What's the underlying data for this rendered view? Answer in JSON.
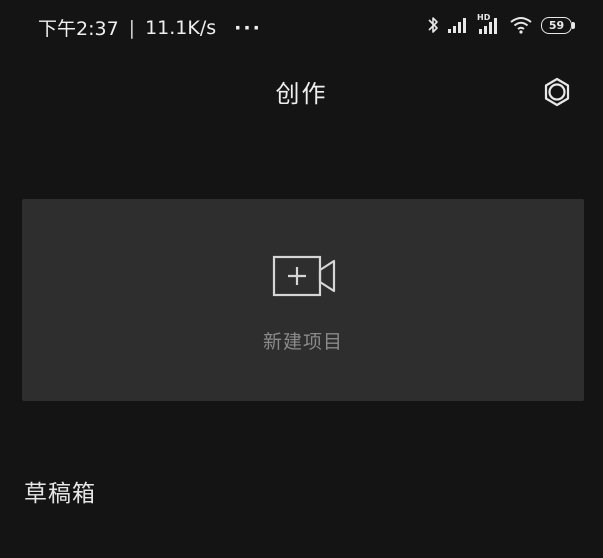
{
  "status_bar": {
    "time": "下午2:37",
    "separator": "|",
    "network_speed": "11.1K/s",
    "more": "···",
    "hd_label": "HD",
    "battery_level": "59",
    "icons": [
      "bluetooth-icon",
      "signal-icon",
      "signal-hd-icon",
      "wifi-icon",
      "battery-icon"
    ]
  },
  "header": {
    "title": "创作",
    "settings_icon": "settings-icon"
  },
  "new_project": {
    "label": "新建项目",
    "icon": "add-video-icon"
  },
  "drafts": {
    "title": "草稿箱"
  },
  "colors": {
    "background": "#141414",
    "card": "#2e2e2e",
    "text": "#e8e8e8",
    "muted_text": "#8a8a8a"
  }
}
